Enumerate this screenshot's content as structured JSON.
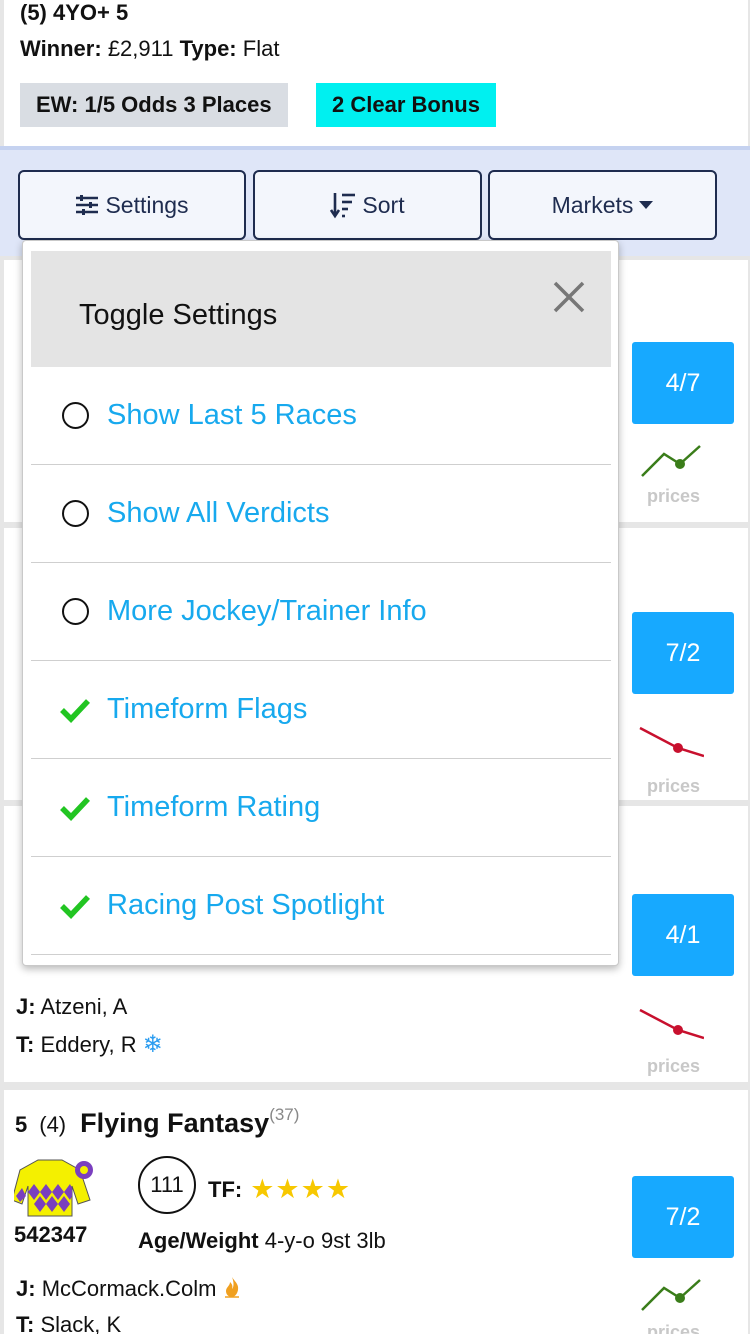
{
  "race": {
    "title": "(5) 4YO+ 5",
    "winner_label": "Winner:",
    "winner_value": "£2,911",
    "type_label": "Type:",
    "type_value": "Flat",
    "ew_badge": "EW: 1/5 Odds 3 Places",
    "bonus_badge": "2 Clear Bonus"
  },
  "toolbar": {
    "settings_label": "Settings",
    "sort_label": "Sort",
    "markets_label": "Markets"
  },
  "settings_panel": {
    "title": "Toggle Settings",
    "items": [
      {
        "label": "Show Last 5 Races",
        "checked": false
      },
      {
        "label": "Show All Verdicts",
        "checked": false
      },
      {
        "label": "More Jockey/Trainer Info",
        "checked": false
      },
      {
        "label": "Timeform Flags",
        "checked": true
      },
      {
        "label": "Timeform Rating",
        "checked": true
      },
      {
        "label": "Racing Post Spotlight",
        "checked": true
      }
    ]
  },
  "runners": [
    {
      "price": "4/7",
      "trend": "up",
      "prices_label": "prices"
    },
    {
      "price": "7/2",
      "trend": "down",
      "prices_label": "prices"
    },
    {
      "price": "4/1",
      "trend": "down",
      "prices_label": "prices",
      "jockey_label": "J:",
      "jockey": "Atzeni, A",
      "trainer_label": "T:",
      "trainer": "Eddery, R"
    },
    {
      "number": "5",
      "draw": "(4)",
      "name": "Flying Fantasy",
      "days": "(37)",
      "form": "542347",
      "rating": "111",
      "tf_label": "TF:",
      "age_weight_label": "Age/Weight",
      "age_weight": "4-y-o 9st 3lb",
      "jockey_label": "J:",
      "jockey": "McCormack.Colm",
      "trainer_label": "T:",
      "trainer": "Slack, K",
      "price": "7/2",
      "trend": "up",
      "prices_label": "prices",
      "stars": 4
    }
  ],
  "colors": {
    "price_button": "#17a9ff",
    "link_blue": "#17a9ee",
    "check_green": "#22c522",
    "bonus_cyan": "#00f0f0",
    "trend_up": "#3a7d1a",
    "trend_down": "#c8102e",
    "star_yellow": "#f7c800"
  }
}
